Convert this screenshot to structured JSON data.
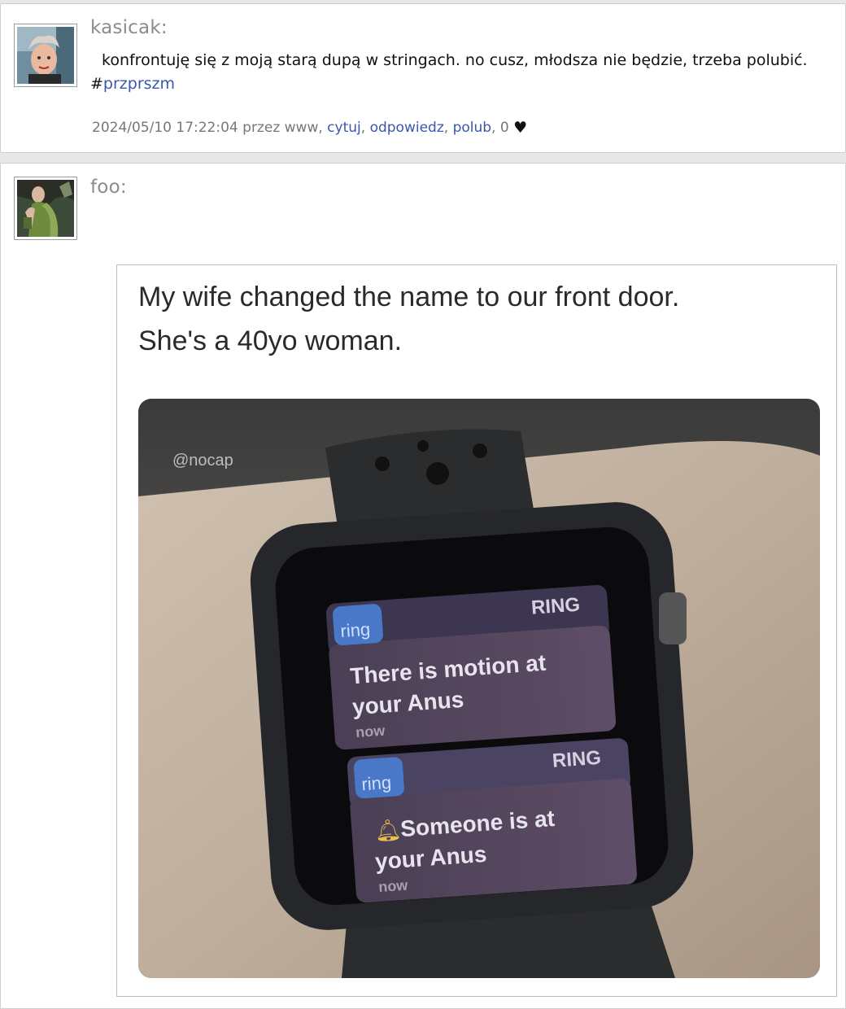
{
  "posts": [
    {
      "username": "kasicak:",
      "text": "konfrontuję się z moją starą dupą w stringach. no cusz, młodsza nie będzie, trzeba polubić.",
      "hash_symbol": "#",
      "hashtag": "przprszm",
      "meta": {
        "timestamp": "2024/05/10 17:22:04",
        "via": "przez www,",
        "quote_label": "cytuj",
        "reply_label": "odpowiedz",
        "like_label": "polub",
        "like_count": "0",
        "sep": ","
      }
    },
    {
      "username": "foo:",
      "meme": {
        "caption_line1": "My wife changed the name to our front door.",
        "caption_line2": "She's a 40yo woman.",
        "watermark": "@nocap",
        "notif1": {
          "app": "ring",
          "brand": "RING",
          "line1": "There is motion at",
          "line2": "your Anus",
          "time": "now"
        },
        "notif2": {
          "app": "ring",
          "brand": "RING",
          "line1": "Someone is at",
          "line2": "your Anus",
          "time": "now"
        }
      }
    }
  ],
  "colors": {
    "link": "#3a56b0",
    "username": "#8c8c8c",
    "meta": "#777777"
  },
  "icons": {
    "heart": "heart-icon"
  }
}
